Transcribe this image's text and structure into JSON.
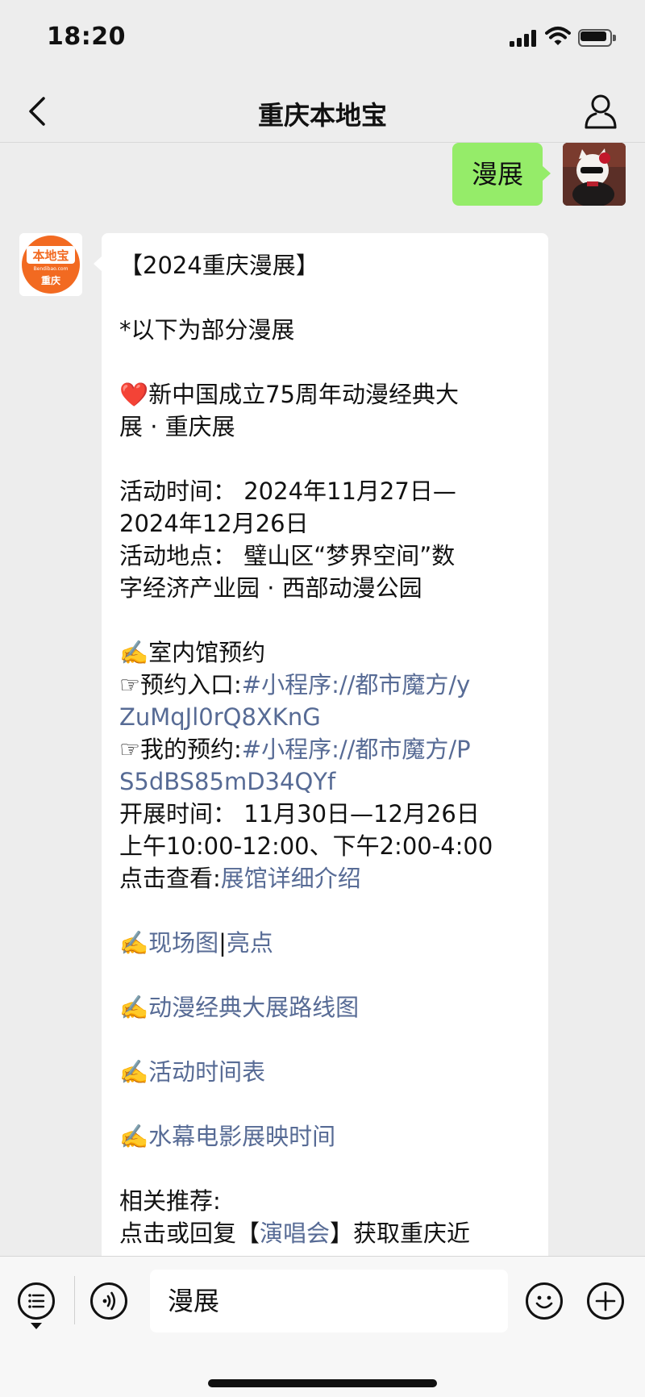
{
  "status_bar": {
    "time": "18:20"
  },
  "nav": {
    "title": "重庆本地宝"
  },
  "chat": {
    "user_message": "漫展",
    "bot_logo": {
      "top": "本地宝",
      "sub": "Bendibao.com",
      "city": "重庆"
    },
    "bot_message": {
      "title": "【2024重庆漫展】",
      "note": "*以下为部分漫展",
      "event_heart": "❤️",
      "event_name_1": "新中国成立75周年动漫经典大",
      "event_name_2": "展 · 重庆展",
      "time_1": "活动时间： 2024年11月27日—",
      "time_2": "2024年12月26日",
      "place_1": "活动地点： 璧山区“梦界空间”数",
      "place_2": "字经济产业园 · 西部动漫公园",
      "hand": "✍️",
      "indoor": "室内馆预约",
      "entry_label": "☞预约入口:",
      "entry_link_1": "#小程序://都市魔方/y",
      "entry_link_2": "ZuMqJl0rQ8XKnG",
      "mine_label": "☞我的预约:",
      "mine_link_1": "#小程序://都市魔方/P",
      "mine_link_2": "S5dBS85mD34QYf",
      "open_time": "开展时间： 11月30日—12月26日",
      "open_hours": "上午10:00-12:00、下午2:00-4:00",
      "click_label": "点击查看:",
      "click_link": "展馆详细介绍",
      "scene_link": "现场图",
      "sep": "|",
      "highlight_link": "亮点",
      "route_link": "动漫经典大展路线图",
      "schedule_link": "活动时间表",
      "film_link": "水幕电影展映时间",
      "related": "相关推荐:",
      "reply_prefix": "点击或回复【",
      "reply_link": "演唱会",
      "reply_suffix": "】获取重庆近"
    }
  },
  "input_bar": {
    "text": "漫展"
  },
  "colors": {
    "user_bubble": "#95ec69",
    "link": "#576b95",
    "logo_orange": "#f26a21"
  },
  "icons": [
    "signal-icon",
    "wifi-icon",
    "battery-icon",
    "back-icon",
    "user-icon",
    "menu-list-icon",
    "voice-icon",
    "emoji-icon",
    "plus-icon"
  ]
}
